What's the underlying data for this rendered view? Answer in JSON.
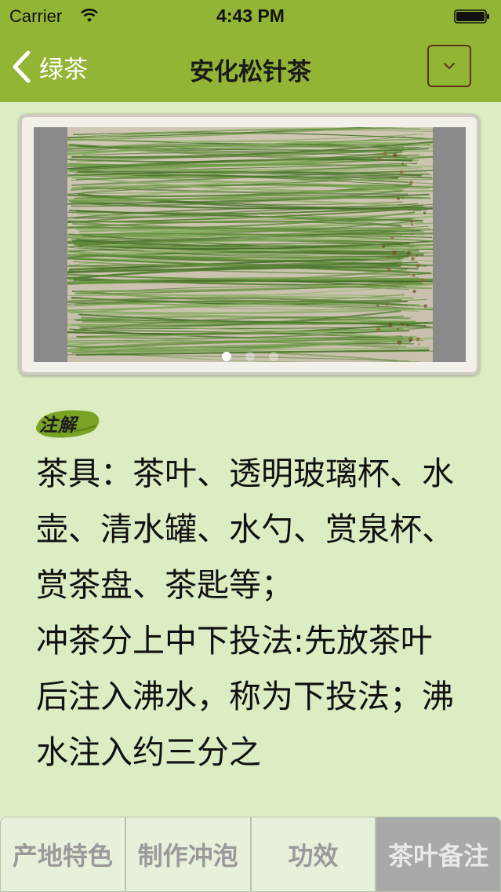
{
  "status_bar": {
    "carrier": "Carrier",
    "time": "4:43 PM",
    "wifi_icon": "wifi-icon",
    "battery_icon": "battery-icon"
  },
  "nav": {
    "back_label": "绿茶",
    "title": "安化松针茶",
    "dropdown_icon": "chevron-down-icon"
  },
  "gallery": {
    "page_count": 3,
    "current_page": 1
  },
  "note": {
    "badge_label": "注解",
    "text": "茶具：茶叶、透明玻璃杯、水壶、清水罐、水勺、赏泉杯、赏茶盘、茶匙等；\n冲茶分上中下投法:先放茶叶后注入沸水，称为下投法；沸水注入约三分之"
  },
  "tabs": [
    {
      "label": "产地特色",
      "selected": false
    },
    {
      "label": "制作冲泡",
      "selected": false
    },
    {
      "label": "功效",
      "selected": false
    },
    {
      "label": "茶叶备注",
      "selected": true
    }
  ],
  "colors": {
    "nav_bar": "#93b535",
    "page_background": "#dcedc4",
    "selected_tab": "#a9a9a9",
    "dropdown_border": "#5a3317"
  }
}
